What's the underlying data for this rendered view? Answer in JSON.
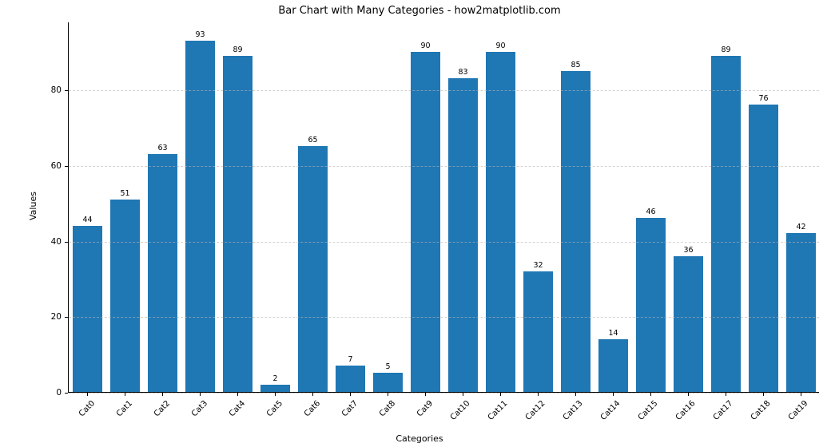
{
  "chart_data": {
    "type": "bar",
    "title": "Bar Chart with Many Categories - how2matplotlib.com",
    "xlabel": "Categories",
    "ylabel": "Values",
    "categories": [
      "Cat0",
      "Cat1",
      "Cat2",
      "Cat3",
      "Cat4",
      "Cat5",
      "Cat6",
      "Cat7",
      "Cat8",
      "Cat9",
      "Cat10",
      "Cat11",
      "Cat12",
      "Cat13",
      "Cat14",
      "Cat15",
      "Cat16",
      "Cat17",
      "Cat18",
      "Cat19"
    ],
    "values": [
      44,
      51,
      63,
      93,
      89,
      2,
      65,
      7,
      5,
      90,
      83,
      90,
      32,
      85,
      14,
      46,
      36,
      89,
      76,
      42
    ],
    "ylim": [
      0,
      98
    ],
    "y_ticks": [
      0,
      20,
      40,
      60,
      80
    ],
    "bar_color": "#1f77b4",
    "grid_axis": "y",
    "grid_style": "dashed"
  }
}
